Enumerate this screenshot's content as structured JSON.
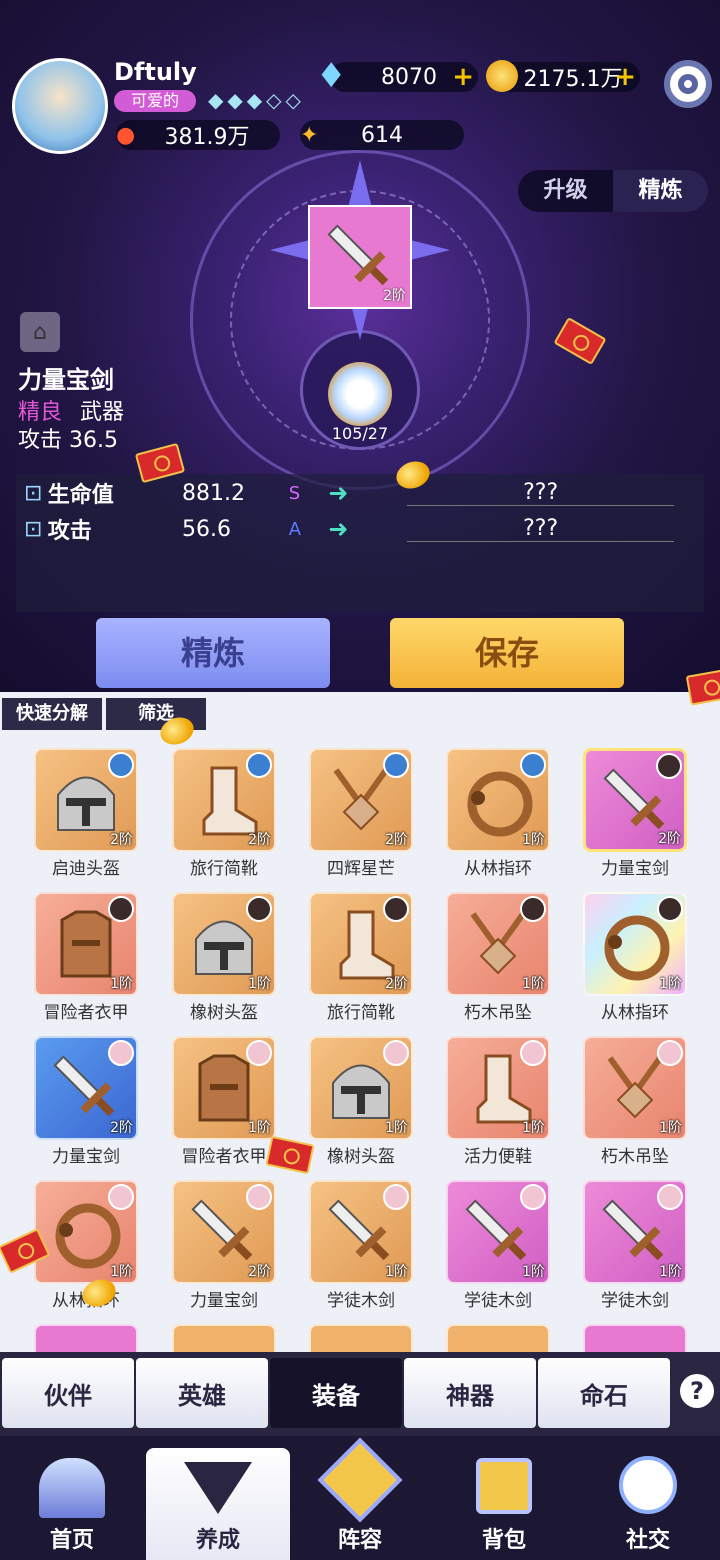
{
  "player": {
    "name": "Dftuly",
    "title": "可爱的",
    "power": "381.9万",
    "stars": "614"
  },
  "currency": {
    "diamonds": "8070",
    "gold": "2175.1万"
  },
  "mode_tabs": {
    "upgrade": "升级",
    "refine": "精炼"
  },
  "item": {
    "level": "2阶",
    "name": "力量宝剑",
    "quality": "精良",
    "type": "武器",
    "attack": "攻击 36.5",
    "material_count": "105/27"
  },
  "stats": [
    {
      "label": "生命值",
      "value": "881.2",
      "grade": "S",
      "result": "???"
    },
    {
      "label": "攻击",
      "value": "56.6",
      "grade": "A",
      "result": "???"
    }
  ],
  "buttons": {
    "refine": "精炼",
    "save": "保存",
    "quick_decompose": "快速分解",
    "filter": "筛选"
  },
  "items": [
    {
      "name": "启迪头盔",
      "lvl": "2阶",
      "icon": "helmet-icon",
      "bg": "orange"
    },
    {
      "name": "旅行简靴",
      "lvl": "2阶",
      "icon": "boot-icon",
      "bg": "orange"
    },
    {
      "name": "四辉星芒",
      "lvl": "2阶",
      "icon": "pendant-icon",
      "bg": "orange"
    },
    {
      "name": "从林指环",
      "lvl": "1阶",
      "icon": "ring-icon",
      "bg": "orange"
    },
    {
      "name": "力量宝剑",
      "lvl": "2阶",
      "icon": "sword-icon",
      "bg": "pink"
    },
    {
      "name": "冒险者衣甲",
      "lvl": "1阶",
      "icon": "armor-icon",
      "bg": "salmon"
    },
    {
      "name": "橡树头盔",
      "lvl": "1阶",
      "icon": "helmet-icon",
      "bg": "orange"
    },
    {
      "name": "旅行简靴",
      "lvl": "2阶",
      "icon": "boot-icon",
      "bg": "orange"
    },
    {
      "name": "朽木吊坠",
      "lvl": "1阶",
      "icon": "pendant-icon",
      "bg": "salmon"
    },
    {
      "name": "从林指环",
      "lvl": "1阶",
      "icon": "ring-icon",
      "bg": "rainbow"
    },
    {
      "name": "力量宝剑",
      "lvl": "2阶",
      "icon": "sword-icon",
      "bg": "blue"
    },
    {
      "name": "冒险者衣甲",
      "lvl": "1阶",
      "icon": "armor-icon",
      "bg": "orange"
    },
    {
      "name": "橡树头盔",
      "lvl": "1阶",
      "icon": "helmet-icon",
      "bg": "orange"
    },
    {
      "name": "活力便鞋",
      "lvl": "1阶",
      "icon": "boot-icon",
      "bg": "salmon"
    },
    {
      "name": "朽木吊坠",
      "lvl": "1阶",
      "icon": "pendant-icon",
      "bg": "salmon"
    },
    {
      "name": "从林指环",
      "lvl": "1阶",
      "icon": "ring-icon",
      "bg": "salmon"
    },
    {
      "name": "力量宝剑",
      "lvl": "2阶",
      "icon": "sword-icon",
      "bg": "orange"
    },
    {
      "name": "学徒木剑",
      "lvl": "1阶",
      "icon": "sword-icon",
      "bg": "orange"
    },
    {
      "name": "学徒木剑",
      "lvl": "1阶",
      "icon": "sword-icon",
      "bg": "pink"
    },
    {
      "name": "学徒木剑",
      "lvl": "1阶",
      "icon": "sword-icon",
      "bg": "pink"
    }
  ],
  "tabs": [
    "伙伴",
    "英雄",
    "装备",
    "神器",
    "命石"
  ],
  "nav": [
    "首页",
    "养成",
    "阵容",
    "背包",
    "社交"
  ],
  "colors": {
    "orange": "#f0b26a",
    "pink": "#e77ad0",
    "salmon": "#ef9c86",
    "blue": "#4b84e6",
    "refine_btn": "#8f9ef5",
    "save_btn": "#f7c34f",
    "accent_purple": "#6b3fd0"
  }
}
